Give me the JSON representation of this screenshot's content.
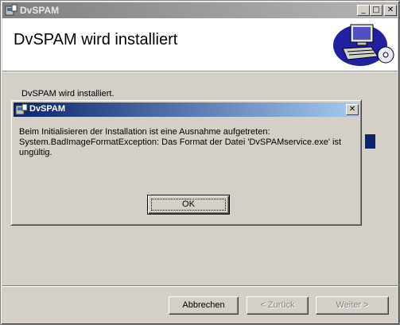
{
  "window": {
    "title": "DvSPAM",
    "minimize_icon": "minimize-icon",
    "maximize_icon": "maximize-icon",
    "close_icon": "close-icon"
  },
  "header": {
    "heading": "DvSPAM wird installiert",
    "logo_icon": "computer-cd-icon"
  },
  "main": {
    "status": "DvSPAM wird installiert."
  },
  "footer": {
    "cancel_label": "Abbrechen",
    "back_label": "< Zurück",
    "next_label": "Weiter >"
  },
  "dialog": {
    "title": "DvSPAM",
    "message_lines": [
      "Beim Initialisieren der Installation ist eine Ausnahme aufgetreten:",
      "System.BadImageFormatException: Das Format der Datei 'DvSPAMservice.exe' ist",
      "ungültig."
    ],
    "ok_label": "OK"
  },
  "colors": {
    "dialog_titlebar": "#0a246a",
    "inactive_titlebar": "#808080",
    "face": "#d4d0c8"
  }
}
